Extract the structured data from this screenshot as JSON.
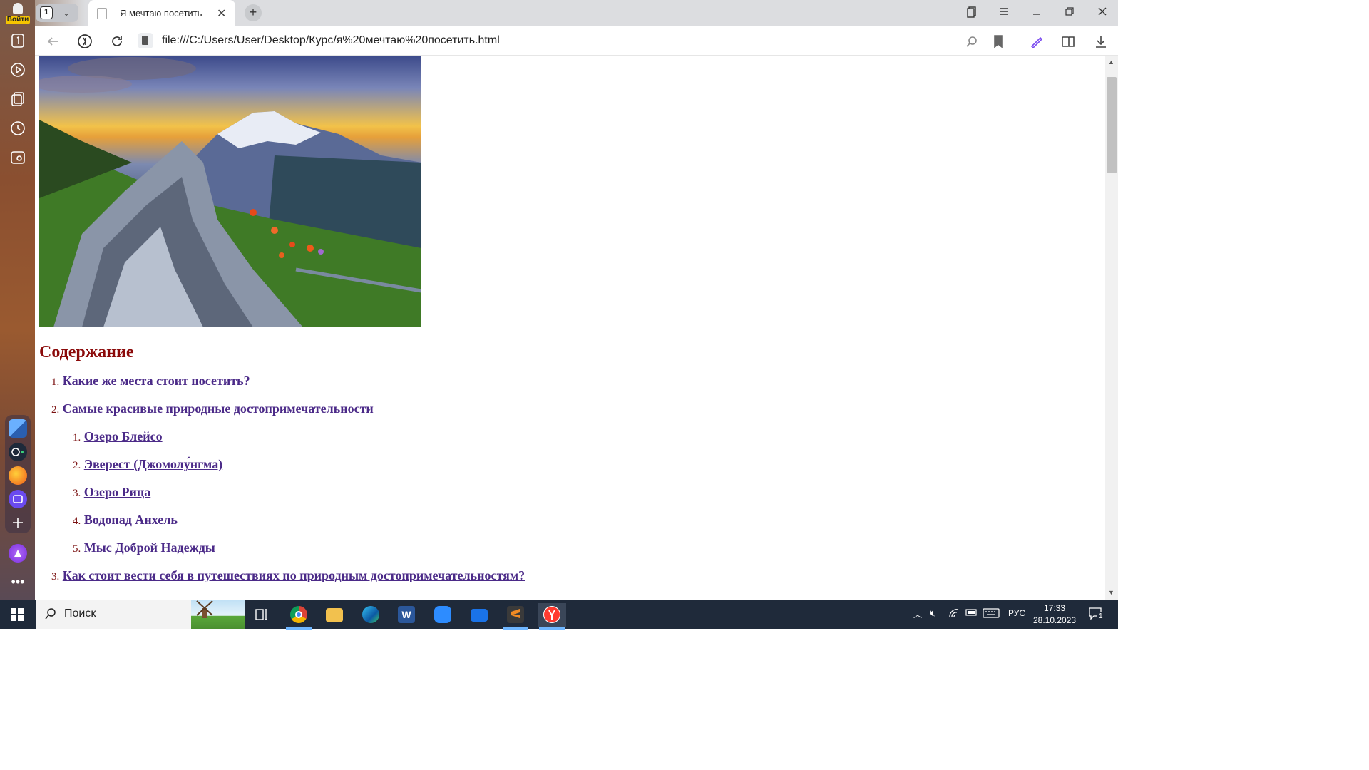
{
  "sidebar": {
    "login_label": "Войти",
    "items": [
      {
        "icon": "tab-counter-icon"
      },
      {
        "icon": "play-icon"
      },
      {
        "icon": "collections-icon"
      },
      {
        "icon": "history-icon"
      },
      {
        "icon": "screenshot-icon"
      }
    ],
    "apps": [
      {
        "icon": "widget-app-icon",
        "color": "#3a78c9"
      },
      {
        "icon": "media-app-icon",
        "color": "#1e2a3a"
      },
      {
        "icon": "orange-app-icon",
        "color": "#f07a1a"
      },
      {
        "icon": "messenger-app-icon",
        "color": "#6a4af0"
      },
      {
        "icon": "add-app-icon",
        "color": "#ffffff"
      }
    ],
    "alice_color": "#8a3ef0",
    "more_icon": "more-dots-icon"
  },
  "tabbar": {
    "tab_count": "1",
    "active_tab_title": "Я мечтаю посетить",
    "close_symbol": "✕",
    "new_tab_symbol": "+"
  },
  "addressbar": {
    "url": "file:///C:/Users/User/Desktop/Курс/я%20мечтаю%20посетить.html"
  },
  "page": {
    "image_alt": "Mountain landscape",
    "toc_title": "Содержание",
    "toc": [
      {
        "num": "1.",
        "label": "Какие же места стоит посетить?"
      },
      {
        "num": "2.",
        "label": "Самые красивые природные достопримечательности",
        "children": [
          {
            "num": "1.",
            "label": "Озеро Блейсо"
          },
          {
            "num": "2.",
            "label": "Эверест (Джомолу́нгма)"
          },
          {
            "num": "3.",
            "label": "Озеро Рица"
          },
          {
            "num": "4.",
            "label": "Водопад Анхель"
          },
          {
            "num": "5.",
            "label": "Мыс Доброй Надежды"
          }
        ]
      },
      {
        "num": "3.",
        "label": "Как стоит вести себя в путешествиях по природным достопримечательностям?"
      }
    ],
    "heading_color": "#8b0a0a",
    "link_color": "#4b2a88"
  },
  "taskbar": {
    "search_placeholder": "Поиск",
    "apps": [
      {
        "icon": "task-view-icon"
      },
      {
        "icon": "chrome-icon",
        "color": "#db4437"
      },
      {
        "icon": "file-explorer-icon",
        "color": "#f2c14e"
      },
      {
        "icon": "edge-icon",
        "color": "#1fa1e0"
      },
      {
        "icon": "word-icon",
        "color": "#2b579a"
      },
      {
        "icon": "zoom-icon",
        "color": "#2d8cff"
      },
      {
        "icon": "mail-icon",
        "color": "#1a73e8"
      },
      {
        "icon": "sublime-icon",
        "color": "#f08a24"
      },
      {
        "icon": "yandex-browser-icon",
        "color": "#ff3b30"
      }
    ],
    "language": "РУС",
    "time": "17:33",
    "date": "28.10.2023",
    "notification_count": "1"
  }
}
